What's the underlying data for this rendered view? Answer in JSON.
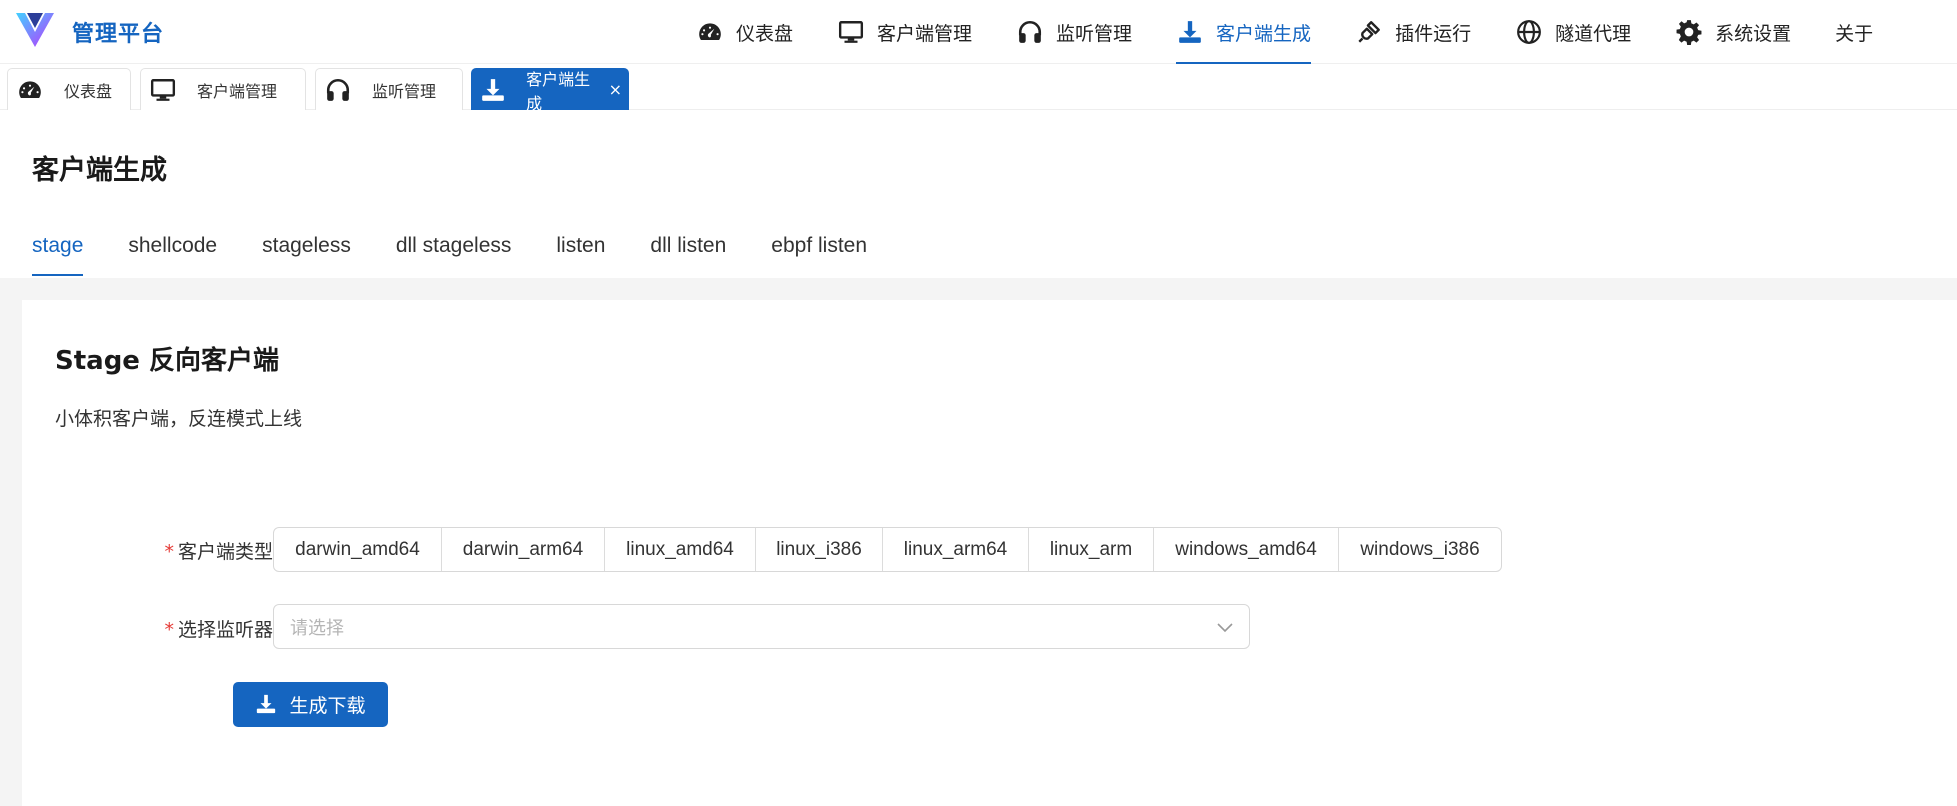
{
  "brand": {
    "title": "管理平台"
  },
  "nav": [
    {
      "label": "仪表盘",
      "icon": "dashboard-icon"
    },
    {
      "label": "客户端管理",
      "icon": "monitor-icon"
    },
    {
      "label": "监听管理",
      "icon": "headphones-icon"
    },
    {
      "label": "客户端生成",
      "icon": "download-icon",
      "active": true
    },
    {
      "label": "插件运行",
      "icon": "plug-icon"
    },
    {
      "label": "隧道代理",
      "icon": "globe-icon"
    },
    {
      "label": "系统设置",
      "icon": "gear-icon"
    },
    {
      "label": "关于",
      "icon": ""
    }
  ],
  "page_tabs": [
    {
      "label": "仪表盘",
      "icon": "dashboard-icon"
    },
    {
      "label": "客户端管理",
      "icon": "monitor-icon"
    },
    {
      "label": "监听管理",
      "icon": "headphones-icon"
    },
    {
      "label": "客户端生成",
      "icon": "download-icon",
      "active": true,
      "close": "×"
    }
  ],
  "page": {
    "title": "客户端生成"
  },
  "subtabs": [
    "stage",
    "shellcode",
    "stageless",
    "dll stageless",
    "listen",
    "dll listen",
    "ebpf listen"
  ],
  "card": {
    "title": "Stage 反向客户端",
    "description": "小体积客户端，反连模式上线"
  },
  "form": {
    "client_type_label": "客户端类型",
    "client_types": [
      "darwin_amd64",
      "darwin_arm64",
      "linux_amd64",
      "linux_i386",
      "linux_arm64",
      "linux_arm",
      "windows_amd64",
      "windows_i386"
    ],
    "listener_label": "选择监听器",
    "listener_placeholder": "请选择",
    "required_mark": "*",
    "generate_label": "生成下载"
  },
  "colors": {
    "primary": "#1565c0",
    "required": "#e53935",
    "bg_gray": "#f4f4f4"
  }
}
